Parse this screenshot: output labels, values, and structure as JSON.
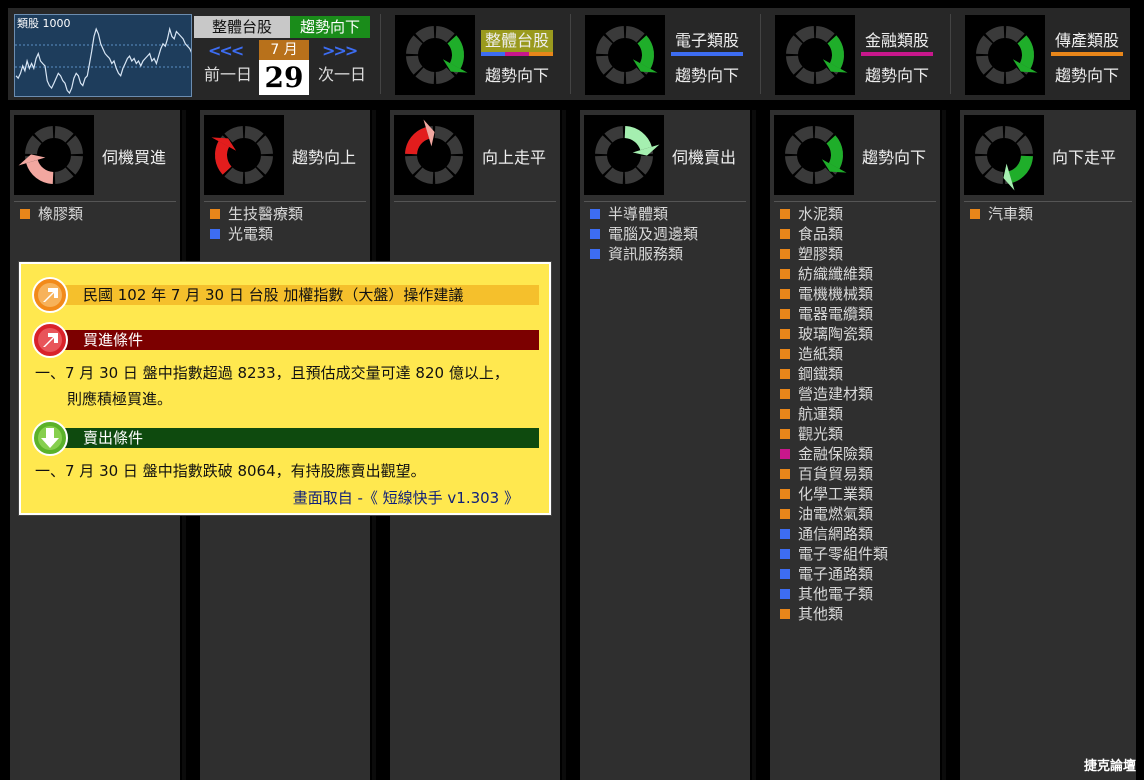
{
  "colors": {
    "orange": "#e8861a",
    "blue": "#3d6df2",
    "magenta": "#c8178c",
    "green_arrow": "#1fae2a",
    "red_arrow": "#e31d1d",
    "pink_arrow": "#f2a7a0",
    "light_green_arrow": "#a5efb0",
    "dark_segment": "#3a3a3a"
  },
  "mini_chart": {
    "title": "類股 1000",
    "values": [
      47,
      46,
      48,
      51,
      49,
      53,
      50,
      52,
      50,
      54,
      56,
      53,
      52,
      51,
      45,
      43,
      42,
      44,
      46,
      48,
      47,
      45,
      44,
      41,
      40,
      42,
      46,
      48,
      47,
      44,
      43,
      46,
      47,
      52,
      57,
      63,
      66,
      64,
      60,
      58,
      56,
      55,
      54,
      52,
      53,
      50,
      48,
      47,
      50,
      52,
      54,
      55,
      53,
      54,
      52,
      53,
      51,
      53,
      54,
      55,
      56,
      53,
      54,
      52,
      55,
      58,
      60,
      59,
      62,
      66,
      63,
      62,
      65,
      64,
      63,
      62,
      60,
      59,
      58,
      56
    ]
  },
  "header": {
    "tab_overall": "整體台股",
    "tab_trend": "趨勢向下",
    "prev_arrows": "<<<",
    "next_arrows": ">>>",
    "month": "7 月",
    "day": "29",
    "prev_day": "前一日",
    "next_day": "次一日"
  },
  "top_categories": [
    {
      "name": "整體台股",
      "trend": "趨勢向下",
      "highlight": "#9a9a1e",
      "lines": [
        "#3d6df2",
        "#c8178c",
        "#e8861a"
      ],
      "icon": "green-down"
    },
    {
      "name": "電子類股",
      "trend": "趨勢向下",
      "highlight": "",
      "lines": [
        "#3d6df2"
      ],
      "icon": "green-down"
    },
    {
      "name": "金融類股",
      "trend": "趨勢向下",
      "highlight": "",
      "lines": [
        "#c8178c"
      ],
      "icon": "green-down"
    },
    {
      "name": "傳產類股",
      "trend": "趨勢向下",
      "highlight": "",
      "lines": [
        "#e8861a"
      ],
      "icon": "green-down"
    }
  ],
  "columns": [
    {
      "title": "伺機買進",
      "icon": "pink-up",
      "items": [
        {
          "label": "橡膠類",
          "color": "#e8861a"
        }
      ]
    },
    {
      "title": "趨勢向上",
      "icon": "red-up",
      "items": [
        {
          "label": "生技醫療類",
          "color": "#e8861a"
        },
        {
          "label": "光電類",
          "color": "#3d6df2"
        }
      ]
    },
    {
      "title": "向上走平",
      "icon": "red-flat",
      "items": []
    },
    {
      "title": "伺機賣出",
      "icon": "lightgreen-down",
      "items": [
        {
          "label": "半導體類",
          "color": "#3d6df2"
        },
        {
          "label": "電腦及週邊類",
          "color": "#3d6df2"
        },
        {
          "label": "資訊服務類",
          "color": "#3d6df2"
        }
      ]
    },
    {
      "title": "趨勢向下",
      "icon": "green-down",
      "items": [
        {
          "label": "水泥類",
          "color": "#e8861a"
        },
        {
          "label": "食品類",
          "color": "#e8861a"
        },
        {
          "label": "塑膠類",
          "color": "#e8861a"
        },
        {
          "label": "紡織纖維類",
          "color": "#e8861a"
        },
        {
          "label": "電機機械類",
          "color": "#e8861a"
        },
        {
          "label": "電器電纜類",
          "color": "#e8861a"
        },
        {
          "label": "玻璃陶瓷類",
          "color": "#e8861a"
        },
        {
          "label": "造紙類",
          "color": "#e8861a"
        },
        {
          "label": "鋼鐵類",
          "color": "#e8861a"
        },
        {
          "label": "營造建材類",
          "color": "#e8861a"
        },
        {
          "label": "航運類",
          "color": "#e8861a"
        },
        {
          "label": "觀光類",
          "color": "#e8861a"
        },
        {
          "label": "金融保險類",
          "color": "#c8178c"
        },
        {
          "label": "百貨貿易類",
          "color": "#e8861a"
        },
        {
          "label": "化學工業類",
          "color": "#e8861a"
        },
        {
          "label": "油電燃氣類",
          "color": "#e8861a"
        },
        {
          "label": "通信網路類",
          "color": "#3d6df2"
        },
        {
          "label": "電子零組件類",
          "color": "#3d6df2"
        },
        {
          "label": "電子通路類",
          "color": "#3d6df2"
        },
        {
          "label": "其他電子類",
          "color": "#3d6df2"
        },
        {
          "label": "其他類",
          "color": "#e8861a"
        }
      ]
    },
    {
      "title": "向下走平",
      "icon": "green-flat",
      "items": [
        {
          "label": "汽車類",
          "color": "#e8861a"
        }
      ]
    }
  ],
  "popup": {
    "title": "民國 102 年 7 月 30 日 台股 加權指數（大盤）操作建議",
    "buy_header": "買進條件",
    "buy_line1": "一、7 月 30 日 盤中指數超過 8233，且預估成交量可達 820 億以上，",
    "buy_line2": "則應積極買進。",
    "sell_header": "賣出條件",
    "sell_line1": "一、7 月 30 日 盤中指數跌破 8064，有持股應賣出觀望。",
    "credit": "畫面取自 -《 短線快手 v1.303 》"
  },
  "brand": "捷克論壇"
}
